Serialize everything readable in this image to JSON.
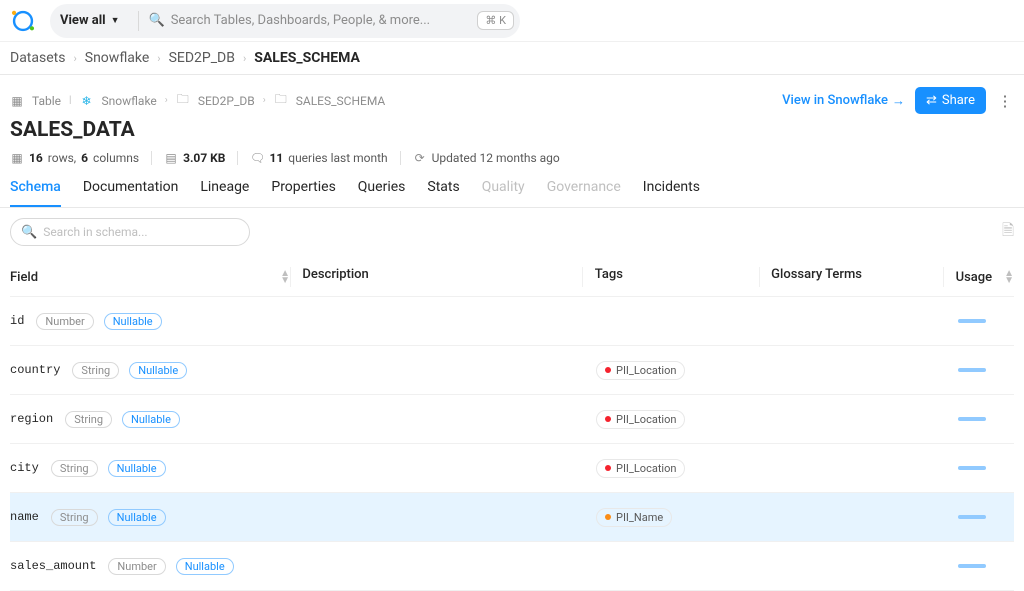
{
  "topbar": {
    "viewall_label": "View all",
    "search_placeholder": "Search Tables, Dashboards, People, & more...",
    "kbd": "⌘ K"
  },
  "breadcrumb": [
    {
      "label": "Datasets"
    },
    {
      "label": "Snowflake"
    },
    {
      "label": "SED2P_DB"
    },
    {
      "label": "SALES_SCHEMA"
    }
  ],
  "entity_crumb": {
    "type": "Table",
    "platform": "Snowflake",
    "path": [
      "SED2P_DB",
      "SALES_SCHEMA"
    ]
  },
  "title": "SALES_DATA",
  "actions": {
    "view_in": "View in Snowflake",
    "share": "Share"
  },
  "meta": {
    "rows_cols": {
      "rows": "16",
      "cols": "6",
      "rows_label": "rows,",
      "cols_label": "columns"
    },
    "size": "3.07 KB",
    "queries": {
      "count": "11",
      "label": "queries last month"
    },
    "updated": "Updated 12 months ago"
  },
  "tabs": [
    {
      "label": "Schema",
      "active": true
    },
    {
      "label": "Documentation"
    },
    {
      "label": "Lineage"
    },
    {
      "label": "Properties"
    },
    {
      "label": "Queries"
    },
    {
      "label": "Stats"
    },
    {
      "label": "Quality",
      "disabled": true
    },
    {
      "label": "Governance",
      "disabled": true
    },
    {
      "label": "Incidents"
    }
  ],
  "schema_search_placeholder": "Search in schema...",
  "columns": {
    "field": "Field",
    "description": "Description",
    "tags": "Tags",
    "glossary": "Glossary Terms",
    "usage": "Usage"
  },
  "nullable_label": "Nullable",
  "fields": [
    {
      "name": "id",
      "type": "Number",
      "nullable": true,
      "tags": [],
      "usage": 28
    },
    {
      "name": "country",
      "type": "String",
      "nullable": true,
      "tags": [
        {
          "label": "PII_Location",
          "dot": "red"
        }
      ],
      "usage": 28
    },
    {
      "name": "region",
      "type": "String",
      "nullable": true,
      "tags": [
        {
          "label": "PII_Location",
          "dot": "red"
        }
      ],
      "usage": 28
    },
    {
      "name": "city",
      "type": "String",
      "nullable": true,
      "tags": [
        {
          "label": "PII_Location",
          "dot": "red"
        }
      ],
      "usage": 28
    },
    {
      "name": "name",
      "type": "String",
      "nullable": true,
      "tags": [
        {
          "label": "PII_Name",
          "dot": "orange"
        }
      ],
      "usage": 28,
      "highlight": true
    },
    {
      "name": "sales_amount",
      "type": "Number",
      "nullable": true,
      "tags": [],
      "usage": 28
    }
  ]
}
